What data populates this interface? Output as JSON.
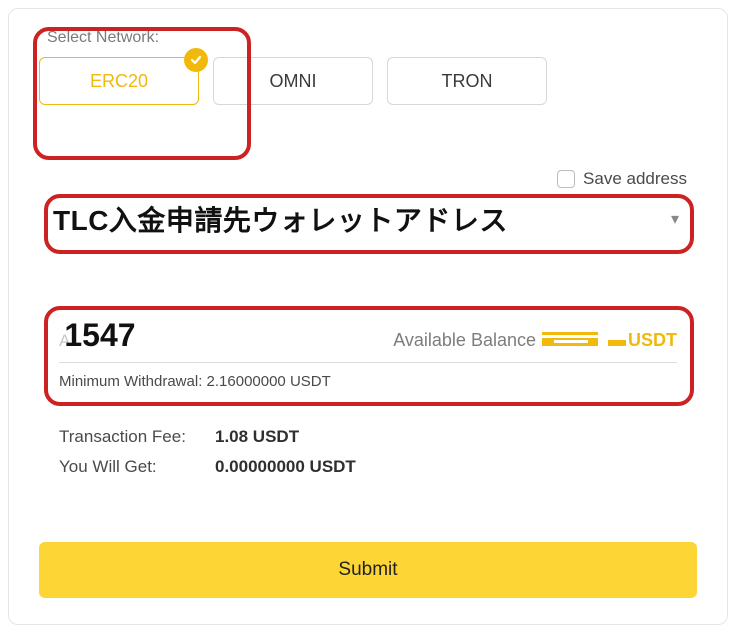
{
  "network": {
    "label": "Select Network:",
    "tabs": [
      "ERC20",
      "OMNI",
      "TRON"
    ],
    "selected": "ERC20"
  },
  "saveAddress": {
    "label": "Save address",
    "checked": false
  },
  "address": {
    "value": "TLC入金申請先ウォレットアドレス"
  },
  "amount": {
    "value": "1547",
    "availableLabel": "Available Balance",
    "currencySuffix": "USDT"
  },
  "minWithdrawal": {
    "label": "Minimum Withdrawal:",
    "value": "2.16000000 USDT"
  },
  "fees": {
    "txFeeLabel": "Transaction Fee:",
    "txFeeValue": "1.08 USDT",
    "youGetLabel": "You Will Get:",
    "youGetValue": "0.00000000 USDT"
  },
  "submitLabel": "Submit",
  "colors": {
    "accent": "#f0b90b",
    "highlight": "#cc2222"
  }
}
